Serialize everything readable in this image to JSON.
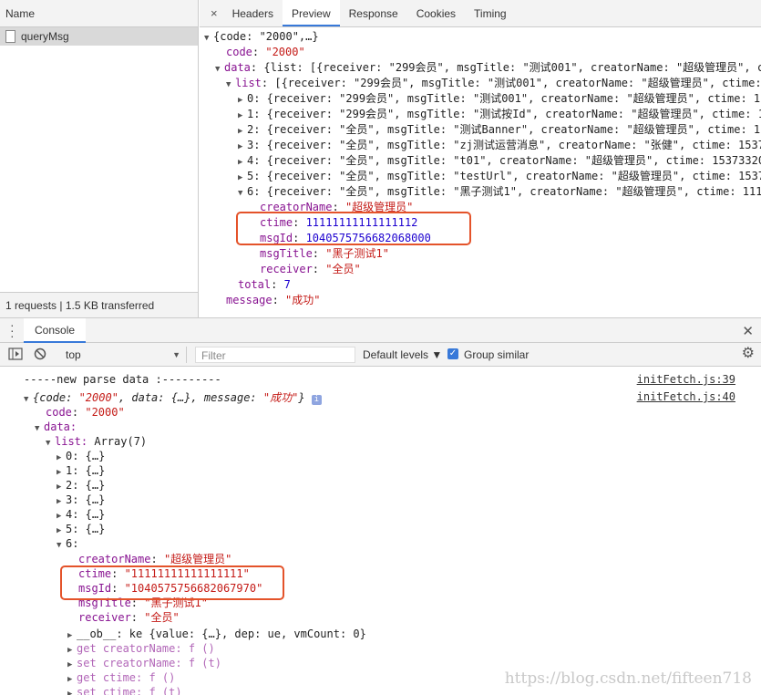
{
  "network": {
    "name_header": "Name",
    "request_name": "queryMsg",
    "footer": "1 requests | 1.5 KB transferred",
    "close_glyph": "×",
    "tabs": [
      "Headers",
      "Preview",
      "Response",
      "Cookies",
      "Timing"
    ],
    "active_tab": "Preview"
  },
  "preview": {
    "root_key": "{code: \"2000\",…}",
    "code_key": "code",
    "code_val": "\"2000\"",
    "data_key": "data",
    "data_summary": "{list: [{receiver: \"299会员\", msgTitle: \"测试001\", creatorName: \"超级管理员\", c",
    "list_key": "list",
    "list_summary": "[{receiver: \"299会员\", msgTitle: \"测试001\", creatorName: \"超级管理员\", ctime:",
    "items": [
      "0: {receiver: \"299会员\", msgTitle: \"测试001\", creatorName: \"超级管理员\", ctime: 1",
      "1: {receiver: \"299会员\", msgTitle: \"测试按Id\", creatorName: \"超级管理员\", ctime: 1",
      "2: {receiver: \"全员\", msgTitle: \"测试Banner\", creatorName: \"超级管理员\", ctime: 1",
      "3: {receiver: \"全员\", msgTitle: \"zj测试运营消息\", creatorName: \"张健\", ctime: 1537",
      "4: {receiver: \"全员\", msgTitle: \"t01\", creatorName: \"超级管理员\", ctime: 15373320",
      "5: {receiver: \"全员\", msgTitle: \"testUrl\", creatorName: \"超级管理员\", ctime: 1537",
      "6: {receiver: \"全员\", msgTitle: \"黑子测试1\", creatorName: \"超级管理员\", ctime: 111"
    ],
    "fields": [
      {
        "key": "creatorName",
        "val": "\"超级管理员\"",
        "kind": "s"
      },
      {
        "key": "ctime",
        "val": "11111111111111112",
        "kind": "n"
      },
      {
        "key": "msgId",
        "val": "1040575756682068000",
        "kind": "n"
      },
      {
        "key": "msgTitle",
        "val": "\"黑子测试1\"",
        "kind": "s"
      },
      {
        "key": "receiver",
        "val": "\"全员\"",
        "kind": "s"
      }
    ],
    "total_key": "total",
    "total_val": "7",
    "message_key": "message",
    "message_val": "\"成功\""
  },
  "drawer": {
    "tab": "Console",
    "close_glyph": "✕"
  },
  "toolbar": {
    "context": "top",
    "filter_placeholder": "Filter",
    "levels": "Default levels ▼",
    "group_similar": "Group similar"
  },
  "console": {
    "log_line": "-----new parse data :---------",
    "log_src1": "initFetch.js:39",
    "log_src2": "initFetch.js:40",
    "obj_summary_open": "{code: ",
    "obj_code": "\"2000\"",
    "obj_mid": ", data: {…}, message: ",
    "obj_msg": "\"成功\"",
    "obj_close": "}",
    "info_badge": "i",
    "code_key": "code",
    "code_val": "\"2000\"",
    "data_key": "data:",
    "list_key": "list:",
    "list_val": "Array(7)",
    "collapsed": [
      "0: {…}",
      "1: {…}",
      "2: {…}",
      "3: {…}",
      "4: {…}",
      "5: {…}"
    ],
    "item6": "6:",
    "fields": [
      {
        "key": "creatorName",
        "val": "\"超级管理员\""
      },
      {
        "key": "ctime",
        "val": "\"11111111111111111\""
      },
      {
        "key": "msgId",
        "val": "\"1040575756682067970\""
      },
      {
        "key": "msgTitle",
        "val": "\"黑子测试1\""
      },
      {
        "key": "receiver",
        "val": "\"全员\""
      }
    ],
    "ob_line": "__ob__: ke {value: {…}, dep: ue, vmCount: 0}",
    "accessors": [
      "get creatorName: f ()",
      "set creatorName: f (t)",
      "get ctime: f ()",
      "set ctime: f (t)"
    ]
  },
  "watermark": "https://blog.csdn.net/fifteen718",
  "colors": {
    "accent": "#3879d9",
    "highlight": "#e4532a"
  }
}
